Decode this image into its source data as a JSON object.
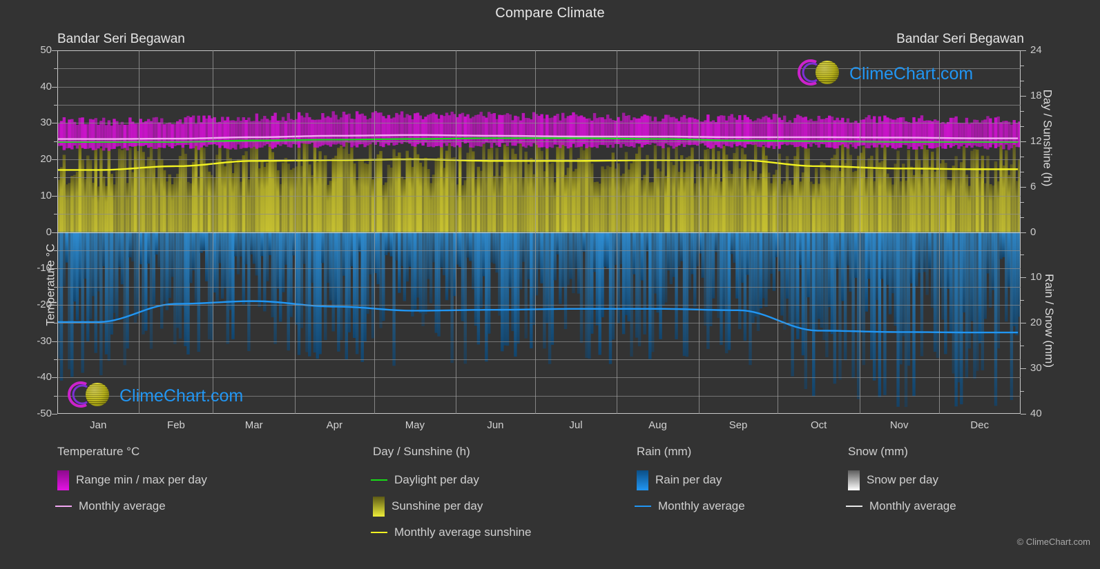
{
  "header": {
    "title": "Compare Climate",
    "subtitle_left": "Bandar Seri Begawan",
    "subtitle_right": "Bandar Seri Begawan"
  },
  "brand": {
    "name": "ClimeChart.com",
    "copyright": "© ClimeChart.com",
    "logo_ring_color": "#cc22cc",
    "logo_sphere_color": "#d6d020",
    "logo_text_color": "#2196f3"
  },
  "axes": {
    "left_label": "Temperature °C",
    "left_ticks": [
      "50",
      "40",
      "30",
      "20",
      "10",
      "0",
      "-10",
      "-20",
      "-30",
      "-40",
      "-50"
    ],
    "left_min": -50,
    "left_max": 50,
    "right_top_label": "Day / Sunshine (h)",
    "right_top_ticks": [
      "24",
      "18",
      "12",
      "6",
      "0"
    ],
    "right_top_min": 0,
    "right_top_max": 24,
    "right_bottom_label": "Rain / Snow (mm)",
    "right_bottom_ticks": [
      "0",
      "10",
      "20",
      "30",
      "40"
    ],
    "right_bottom_min": 0,
    "right_bottom_max": 40,
    "x_ticks": [
      "Jan",
      "Feb",
      "Mar",
      "Apr",
      "May",
      "Jun",
      "Jul",
      "Aug",
      "Sep",
      "Oct",
      "Nov",
      "Dec"
    ]
  },
  "legend": {
    "groups": [
      {
        "title": "Temperature °C",
        "items": [
          {
            "label": "Range min / max per day",
            "marker": "swatch",
            "color": "#e413e4",
            "color2": "#8d0a8d"
          },
          {
            "label": "Monthly average",
            "marker": "line",
            "color": "#f3a8f3"
          }
        ]
      },
      {
        "title": "Day / Sunshine (h)",
        "items": [
          {
            "label": "Daylight per day",
            "marker": "line",
            "color": "#16dd16"
          },
          {
            "label": "Sunshine per day",
            "marker": "swatch",
            "color": "#eded3a",
            "color2": "#5d5a15"
          },
          {
            "label": "Monthly average sunshine",
            "marker": "line",
            "color": "#f2f222"
          }
        ]
      },
      {
        "title": "Rain (mm)",
        "items": [
          {
            "label": "Rain per day",
            "marker": "swatch",
            "color": "#2196f3",
            "color2": "#0b4f86"
          },
          {
            "label": "Monthly average",
            "marker": "line",
            "color": "#2196f3"
          }
        ]
      },
      {
        "title": "Snow (mm)",
        "items": [
          {
            "label": "Snow per day",
            "marker": "swatch",
            "color": "#ffffff",
            "color2": "#5d5d5d"
          },
          {
            "label": "Monthly average",
            "marker": "line",
            "color": "#e8e8e8"
          }
        ]
      }
    ]
  },
  "chart_data": {
    "type": "area",
    "title": "Compare Climate",
    "subtitle": "Bandar Seri Begawan",
    "xlabel": "",
    "ylabel": "Temperature °C",
    "ylim": [
      -50,
      50
    ],
    "y2_top_label": "Day / Sunshine (h)",
    "y2_top_lim": [
      0,
      24
    ],
    "y2_bottom_label": "Rain / Snow (mm)",
    "y2_bottom_lim": [
      0,
      40
    ],
    "grid": true,
    "legend_position": "below",
    "categories": [
      "Jan",
      "Feb",
      "Mar",
      "Apr",
      "May",
      "Jun",
      "Jul",
      "Aug",
      "Sep",
      "Oct",
      "Nov",
      "Dec"
    ],
    "series": [
      {
        "name": "Monthly average temperature",
        "unit": "°C",
        "color": "#f3a8f3",
        "values": [
          25.6,
          25.7,
          26.1,
          26.5,
          26.7,
          26.5,
          26.3,
          26.3,
          26.1,
          26.1,
          26.0,
          25.8
        ]
      },
      {
        "name": "Daily max temperature (range top)",
        "unit": "°C",
        "color": "#e413e4",
        "values": [
          30.1,
          30.5,
          31.2,
          31.7,
          31.8,
          31.6,
          31.4,
          31.3,
          31.0,
          30.9,
          30.7,
          30.4
        ]
      },
      {
        "name": "Daily min temperature (range bottom)",
        "unit": "°C",
        "color": "#8d0a8d",
        "values": [
          23.3,
          23.4,
          23.7,
          24.1,
          24.3,
          24.1,
          23.9,
          23.9,
          23.8,
          23.8,
          23.7,
          23.5
        ]
      },
      {
        "name": "Daylight per day",
        "unit": "h",
        "color": "#16dd16",
        "values": [
          11.9,
          11.9,
          12.1,
          12.2,
          12.3,
          12.4,
          12.4,
          12.3,
          12.1,
          12.0,
          11.9,
          11.9
        ]
      },
      {
        "name": "Monthly average sunshine",
        "unit": "h",
        "color": "#f2f222",
        "values": [
          8.2,
          8.7,
          9.4,
          9.5,
          9.6,
          9.4,
          9.4,
          9.5,
          9.5,
          8.7,
          8.4,
          8.3
        ]
      },
      {
        "name": "Sunshine per day (max band)",
        "unit": "h",
        "color": "#eded3a",
        "values": [
          10.9,
          11.0,
          11.2,
          11.3,
          11.3,
          11.2,
          11.2,
          11.2,
          11.1,
          11.0,
          10.9,
          10.9
        ]
      },
      {
        "name": "Monthly average rain",
        "unit": "mm",
        "color": "#2196f3",
        "values": [
          19.8,
          15.8,
          15.2,
          16.4,
          17.3,
          17.1,
          16.9,
          16.9,
          17.2,
          21.7,
          22.0,
          22.1
        ]
      }
    ],
    "annotations": []
  }
}
